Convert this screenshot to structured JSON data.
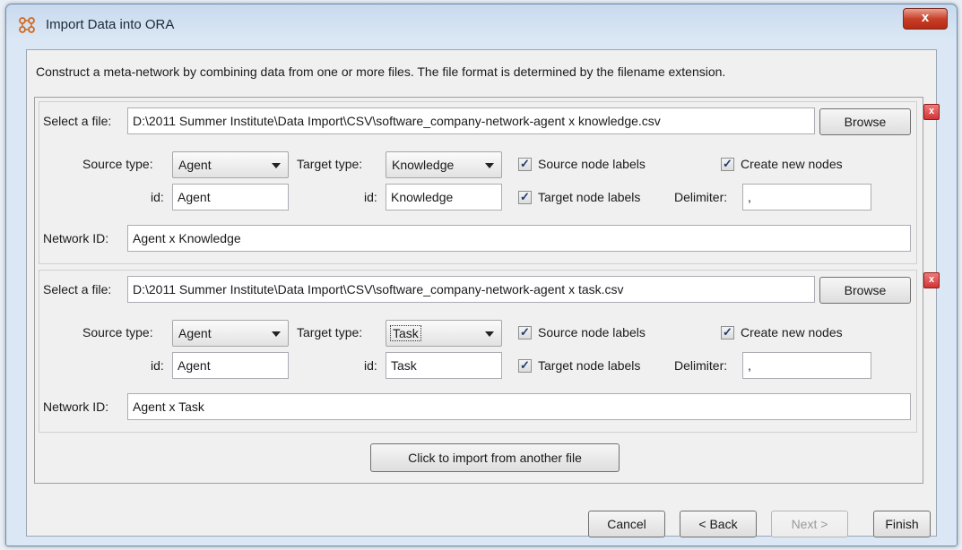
{
  "window": {
    "title": "Import Data into ORA",
    "close_label": "x"
  },
  "description": "Construct a meta-network by combining data from one or more files. The file format is determined by the filename extension.",
  "files": [
    {
      "select_label": "Select a file:",
      "path": "D:\\2011 Summer Institute\\Data Import\\CSV\\software_company-network-agent x knowledge.csv",
      "browse_label": "Browse",
      "source_type_label": "Source type:",
      "source_type": "Agent",
      "target_type_label": "Target type:",
      "target_type": "Knowledge",
      "source_id_label": "id:",
      "source_id": "Agent",
      "target_id_label": "id:",
      "target_id": "Knowledge",
      "source_node_labels": {
        "label": "Source node labels",
        "checked": true
      },
      "target_node_labels": {
        "label": "Target node labels",
        "checked": true
      },
      "create_new_nodes": {
        "label": "Create new nodes",
        "checked": true
      },
      "delimiter_label": "Delimiter:",
      "delimiter": ",",
      "network_id_label": "Network ID:",
      "network_id": "Agent x Knowledge",
      "remove_label": "x"
    },
    {
      "select_label": "Select a file:",
      "path": "D:\\2011 Summer Institute\\Data Import\\CSV\\software_company-network-agent x task.csv",
      "browse_label": "Browse",
      "source_type_label": "Source type:",
      "source_type": "Agent",
      "target_type_label": "Target type:",
      "target_type": "Task",
      "source_id_label": "id:",
      "source_id": "Agent",
      "target_id_label": "id:",
      "target_id": "Task",
      "source_node_labels": {
        "label": "Source node labels",
        "checked": true
      },
      "target_node_labels": {
        "label": "Target node labels",
        "checked": true
      },
      "create_new_nodes": {
        "label": "Create new nodes",
        "checked": true
      },
      "delimiter_label": "Delimiter:",
      "delimiter": ",",
      "network_id_label": "Network ID:",
      "network_id": "Agent x Task",
      "remove_label": "x"
    }
  ],
  "import_another_label": "Click to import from another file",
  "footer": {
    "cancel_label": "Cancel",
    "back_label": "< Back",
    "next_label": "Next >",
    "finish_label": "Finish"
  },
  "check_glyph": "✓"
}
